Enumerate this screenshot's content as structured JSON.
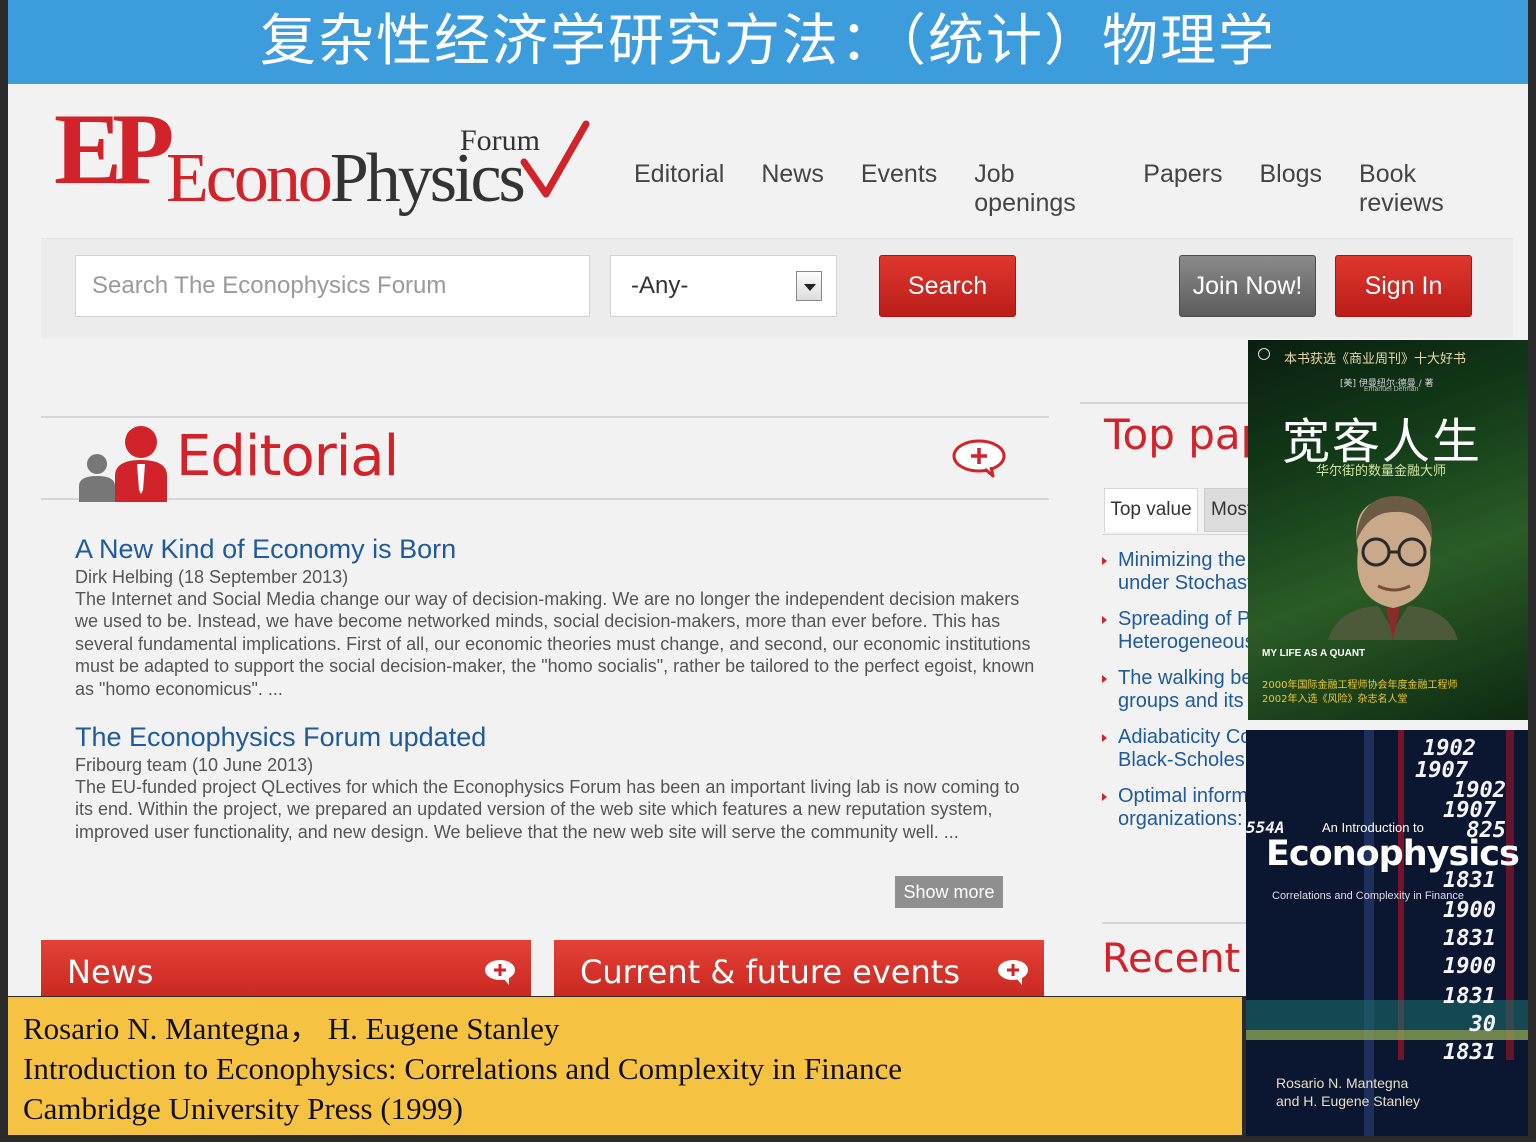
{
  "slide": {
    "title": "复杂性经济学研究方法：（统计）物理学"
  },
  "site": {
    "logo_ep": "EP",
    "logo_econo": "Econo",
    "logo_physics": "Physics",
    "logo_forum": "Forum",
    "nav": [
      "Editorial",
      "News",
      "Events",
      "Job openings",
      "Papers",
      "Blogs",
      "Book reviews"
    ],
    "search": {
      "placeholder": "Search The Econophysics Forum",
      "select_value": "-Any-",
      "button": "Search"
    },
    "join_button": "Join Now!",
    "signin_button": "Sign In"
  },
  "editorial": {
    "title": "Editorial",
    "articles": [
      {
        "title": "A New Kind of Economy is Born",
        "meta": "Dirk Helbing (18 September 2013)",
        "body": "The Internet and Social Media change our way of decision-making. We are no longer the independent decision makers we used to be. Instead, we have become networked minds, social decision-makers, more than ever before. This has several fundamental implications. First of all, our economic theories must change, and second, our economic institutions must be adapted to support the social decision-maker, the \"homo socialis\", rather be tailored to the perfect egoist, known as \"homo economicus\". ..."
      },
      {
        "title": "The Econophysics Forum updated",
        "meta": "Fribourg team (10 June 2013)",
        "body": "The EU-funded project QLectives for which the Econophysics Forum has been an important living lab is now coming to its end. Within the project, we prepared an updated version of the web site which features a new reputation system, improved user functionality, and new design. We believe that the new web site will serve the community well. ..."
      }
    ],
    "show_more": "Show more"
  },
  "bottom_tabs": {
    "news": "News",
    "events": "Current & future events"
  },
  "top_papers": {
    "title": "Top pape",
    "tabs": [
      "Top value",
      "Most"
    ],
    "items": [
      [
        "Minimizing the",
        "under Stochast"
      ],
      [
        "Spreading of Pe",
        "Heterogeneous"
      ],
      [
        "The walking bel",
        "groups and its impact on crowd dynamics"
      ],
      [
        "Adiabaticity Co",
        "Black-Scholes"
      ],
      [
        "Optimal informa",
        "organizations: s"
      ]
    ]
  },
  "recent": {
    "title": "Recent c"
  },
  "book1": {
    "tagline": "本书获选《商业周刊》十大好书",
    "author": "[美] 伊曼纽尔·德曼 / 著",
    "author_latin": "Emanuel Derman",
    "title": "宽客人生",
    "subtitle": "华尔街的数量金融大师",
    "english": "MY LIFE AS A QUANT",
    "award_1": "2000年国际金融工程师协会年度金融工程师",
    "award_2": "2002年入选《风险》杂志名人堂"
  },
  "book2": {
    "ticker": [
      "1902",
      "1907",
      "1902",
      "1907",
      "825",
      "1831",
      "1900",
      "1831",
      "1900",
      "1831",
      "30",
      "1831"
    ],
    "ticker_side": "554A",
    "series": "An Introduction to",
    "title": "Econophysics",
    "subtitle": "Correlations and Complexity in Finance",
    "author_1": "Rosario N. Mantegna",
    "author_2": "and H. Eugene Stanley"
  },
  "citation": {
    "line1": "Rosario N. Mantegna，  H. Eugene Stanley",
    "line2": "Introduction to Econophysics: Correlations and Complexity in Finance",
    "line3": "Cambridge University Press (1999)"
  },
  "colors": {
    "slide_title_bg": "#3c9cdc",
    "brand_red": "#d2232a",
    "link_blue": "#1e5a9c",
    "citation_bg": "#f5c242"
  }
}
